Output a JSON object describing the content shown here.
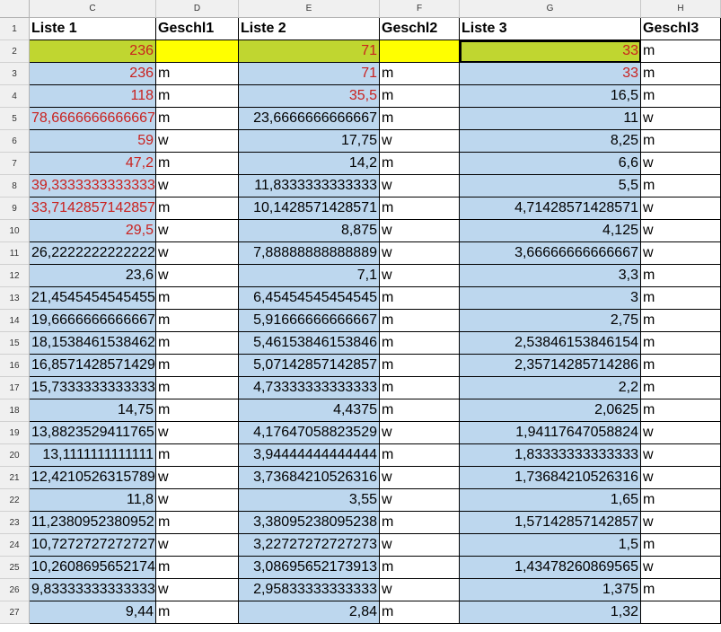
{
  "columns": [
    "C",
    "D",
    "E",
    "F",
    "G",
    "H"
  ],
  "header_row": [
    "Liste 1",
    "Geschl1",
    "Liste 2",
    "Geschl2",
    "Liste 3",
    "Geschl3"
  ],
  "rows": [
    {
      "n": "1"
    },
    {
      "n": "2",
      "c": "236",
      "d": "",
      "e": "71",
      "f": "",
      "g": "33",
      "h": "m"
    },
    {
      "n": "3",
      "c": "236",
      "d": "m",
      "e": "71",
      "f": "m",
      "g": "33",
      "h": "m"
    },
    {
      "n": "4",
      "c": "118",
      "d": "m",
      "e": "35,5",
      "f": "m",
      "g": "16,5",
      "h": "m"
    },
    {
      "n": "5",
      "c": "78,6666666666667",
      "d": "m",
      "e": "23,6666666666667",
      "f": "m",
      "g": "11",
      "h": "w"
    },
    {
      "n": "6",
      "c": "59",
      "d": "w",
      "e": "17,75",
      "f": "w",
      "g": "8,25",
      "h": "m"
    },
    {
      "n": "7",
      "c": "47,2",
      "d": "m",
      "e": "14,2",
      "f": "m",
      "g": "6,6",
      "h": "w"
    },
    {
      "n": "8",
      "c": "39,3333333333333",
      "d": "w",
      "e": "11,8333333333333",
      "f": "w",
      "g": "5,5",
      "h": "m"
    },
    {
      "n": "9",
      "c": "33,7142857142857",
      "d": "m",
      "e": "10,1428571428571",
      "f": "m",
      "g": "4,71428571428571",
      "h": "w"
    },
    {
      "n": "10",
      "c": "29,5",
      "d": "w",
      "e": "8,875",
      "f": "w",
      "g": "4,125",
      "h": "w"
    },
    {
      "n": "11",
      "c": "26,2222222222222",
      "d": "w",
      "e": "7,88888888888889",
      "f": "w",
      "g": "3,66666666666667",
      "h": "w"
    },
    {
      "n": "12",
      "c": "23,6",
      "d": "w",
      "e": "7,1",
      "f": "w",
      "g": "3,3",
      "h": "m"
    },
    {
      "n": "13",
      "c": "21,4545454545455",
      "d": "m",
      "e": "6,45454545454545",
      "f": "m",
      "g": "3",
      "h": "m"
    },
    {
      "n": "14",
      "c": "19,6666666666667",
      "d": "m",
      "e": "5,91666666666667",
      "f": "m",
      "g": "2,75",
      "h": "m"
    },
    {
      "n": "15",
      "c": "18,1538461538462",
      "d": "m",
      "e": "5,46153846153846",
      "f": "m",
      "g": "2,53846153846154",
      "h": "m"
    },
    {
      "n": "16",
      "c": "16,8571428571429",
      "d": "m",
      "e": "5,07142857142857",
      "f": "m",
      "g": "2,35714285714286",
      "h": "m"
    },
    {
      "n": "17",
      "c": "15,7333333333333",
      "d": "m",
      "e": "4,73333333333333",
      "f": "m",
      "g": "2,2",
      "h": "m"
    },
    {
      "n": "18",
      "c": "14,75",
      "d": "m",
      "e": "4,4375",
      "f": "m",
      "g": "2,0625",
      "h": "m"
    },
    {
      "n": "19",
      "c": "13,8823529411765",
      "d": "w",
      "e": "4,17647058823529",
      "f": "w",
      "g": "1,94117647058824",
      "h": "w"
    },
    {
      "n": "20",
      "c": "13,1111111111111",
      "d": "m",
      "e": "3,94444444444444",
      "f": "m",
      "g": "1,83333333333333",
      "h": "w"
    },
    {
      "n": "21",
      "c": "12,4210526315789",
      "d": "w",
      "e": "3,73684210526316",
      "f": "w",
      "g": "1,73684210526316",
      "h": "w"
    },
    {
      "n": "22",
      "c": "11,8",
      "d": "w",
      "e": "3,55",
      "f": "w",
      "g": "1,65",
      "h": "m"
    },
    {
      "n": "23",
      "c": "11,2380952380952",
      "d": "m",
      "e": "3,38095238095238",
      "f": "m",
      "g": "1,57142857142857",
      "h": "w"
    },
    {
      "n": "24",
      "c": "10,7272727272727",
      "d": "w",
      "e": "3,22727272727273",
      "f": "w",
      "g": "1,5",
      "h": "m"
    },
    {
      "n": "25",
      "c": "10,2608695652174",
      "d": "m",
      "e": "3,08695652173913",
      "f": "m",
      "g": "1,43478260869565",
      "h": "w"
    },
    {
      "n": "26",
      "c": "9,83333333333333",
      "d": "w",
      "e": "2,95833333333333",
      "f": "w",
      "g": "1,375",
      "h": "m"
    },
    {
      "n": "27",
      "c": "9,44",
      "d": "m",
      "e": "2,84",
      "f": "m",
      "g": "1,32",
      "h": ""
    }
  ],
  "colors": {
    "highlight_green": "#c0d630",
    "highlight_yellow": "#ffff00",
    "cell_blue": "#bdd7ee",
    "red_text": "#c9211e"
  }
}
